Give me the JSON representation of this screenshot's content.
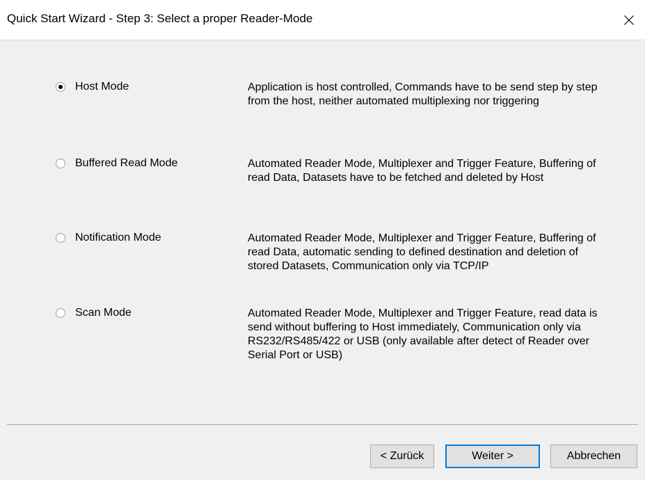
{
  "window": {
    "title": "Quick Start Wizard - Step 3: Select a proper Reader-Mode"
  },
  "options": [
    {
      "label": "Host Mode",
      "checked": true,
      "description": "Application is host controlled, Commands have to be send step by step from the host, neither automated multiplexing nor triggering"
    },
    {
      "label": "Buffered Read Mode",
      "checked": false,
      "description": "Automated Reader Mode, Multiplexer and Trigger Feature, Buffering of read Data, Datasets have to be fetched and deleted by Host"
    },
    {
      "label": "Notification Mode",
      "checked": false,
      "description": "Automated Reader Mode, Multiplexer and Trigger Feature, Buffering of read Data, automatic sending to defined destination and deletion of stored Datasets, Communication only via TCP/IP"
    },
    {
      "label": "Scan Mode",
      "checked": false,
      "description": "Automated Reader Mode, Multiplexer and Trigger Feature, read data is send without buffering to Host immediately, Communication only via RS232/RS485/422 or USB (only available after detect of Reader over Serial Port or USB)"
    }
  ],
  "buttons": {
    "back": "< Zurück",
    "next": "Weiter >",
    "cancel": "Abbrechen"
  },
  "colors": {
    "focus_border": "#0078d7",
    "button_face": "#e1e1e1",
    "dialog_bg": "#f0f0f0"
  }
}
